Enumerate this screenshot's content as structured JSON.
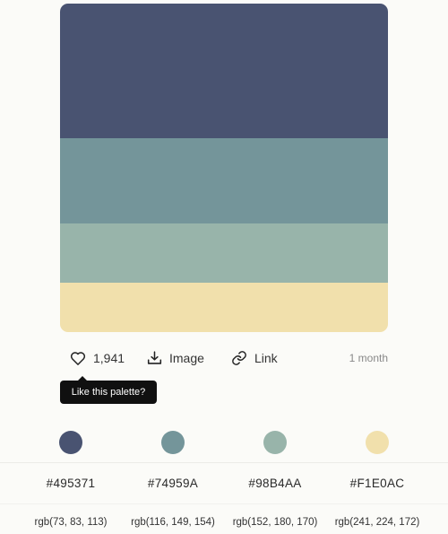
{
  "palette": {
    "swatches": [
      {
        "hex": "#495371",
        "rgb": "rgb(73, 83, 113)",
        "color": "#495371"
      },
      {
        "hex": "#74959A",
        "rgb": "rgb(116, 149, 154)",
        "color": "#74959A"
      },
      {
        "hex": "#98B4AA",
        "rgb": "rgb(152, 180, 170)",
        "color": "#98B4AA"
      },
      {
        "hex": "#F1E0AC",
        "rgb": "rgb(241, 224, 172)",
        "color": "#F1E0AC"
      }
    ]
  },
  "toolbar": {
    "like_count": "1,941",
    "image_label": "Image",
    "link_label": "Link",
    "age": "1 month",
    "icons": {
      "like": "heart-icon",
      "image": "download-icon",
      "link": "link-icon"
    }
  },
  "tooltip": {
    "text": "Like this palette?"
  }
}
